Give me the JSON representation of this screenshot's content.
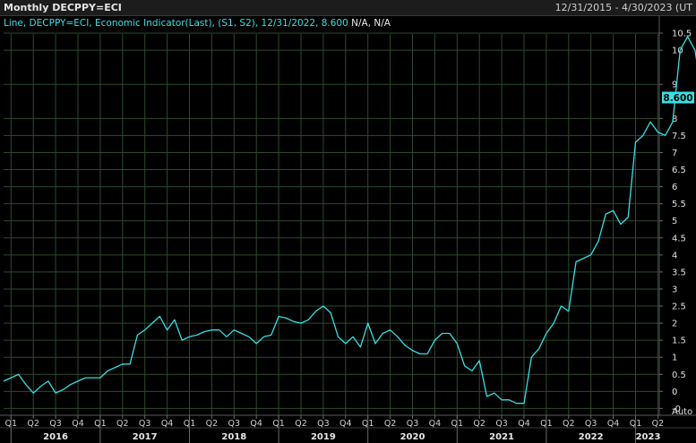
{
  "header": {
    "title": "Monthly DECPPY=ECI",
    "date_range": "12/31/2015 - 4/30/2023 (UT"
  },
  "legend": {
    "text": "Line, DECPPY=ECI, Economic Indicator(Last), (S1, S2), 12/31/2022, 8.600",
    "suffix": "N/A, N/A"
  },
  "axis": {
    "auto_label": "Auto",
    "last_value_label": "8.600"
  },
  "colors": {
    "background": "#000000",
    "line": "#35e0e6",
    "grid": "#2e4a2e",
    "badge": "#35e0e6"
  },
  "chart_data": {
    "type": "line",
    "x_start": "2015-12",
    "x_end": "2023-04",
    "frequency": "monthly",
    "ylim": [
      -0.7,
      11
    ],
    "y_ticks": [
      "-0",
      "0",
      "0.5",
      "1",
      "1.5",
      "2",
      "2.5",
      "3",
      "3.5",
      "4",
      "4.5",
      "5",
      "5.5",
      "6",
      "6.5",
      "7",
      "7.5",
      "8",
      "9",
      "10",
      "10.5"
    ],
    "grid": true,
    "year_labels": [
      "2016",
      "2017",
      "2018",
      "2019",
      "2020",
      "2021",
      "2022",
      "2023"
    ],
    "quarter_labels": [
      "Q1",
      "Q2",
      "Q3",
      "Q4",
      "Q1",
      "Q2",
      "Q3",
      "Q4",
      "Q1",
      "Q2",
      "Q3",
      "Q4",
      "Q1",
      "Q2",
      "Q3",
      "Q4",
      "Q1",
      "Q2",
      "Q3",
      "Q4",
      "Q1",
      "Q2",
      "Q3",
      "Q4",
      "Q1",
      "Q2",
      "Q3",
      "Q4",
      "Q1",
      "Q2"
    ],
    "series": [
      {
        "name": "DECPPY=ECI",
        "values": [
          0.3,
          0.4,
          0.5,
          0.2,
          -0.05,
          0.15,
          0.3,
          -0.05,
          0.05,
          0.2,
          0.3,
          0.4,
          0.4,
          0.4,
          0.6,
          0.7,
          0.8,
          0.8,
          1.65,
          1.8,
          2.0,
          2.2,
          1.8,
          2.1,
          1.5,
          1.6,
          1.65,
          1.75,
          1.8,
          1.8,
          1.6,
          1.8,
          1.7,
          1.6,
          1.4,
          1.6,
          1.65,
          2.2,
          2.15,
          2.05,
          2.0,
          2.1,
          2.35,
          2.5,
          2.3,
          1.6,
          1.4,
          1.6,
          1.3,
          2.0,
          1.4,
          1.7,
          1.8,
          1.6,
          1.35,
          1.2,
          1.1,
          1.1,
          1.5,
          1.7,
          1.7,
          1.4,
          0.75,
          0.6,
          0.9,
          -0.15,
          -0.05,
          -0.25,
          -0.25,
          -0.35,
          -0.35,
          1.0,
          1.25,
          1.7,
          2.0,
          2.5,
          2.35,
          3.8,
          3.9,
          4.0,
          4.4,
          5.2,
          5.3,
          4.9,
          5.1,
          7.3,
          7.5,
          7.9,
          7.6,
          7.5,
          7.9,
          10.0,
          10.4,
          10.0,
          8.6
        ]
      }
    ]
  }
}
